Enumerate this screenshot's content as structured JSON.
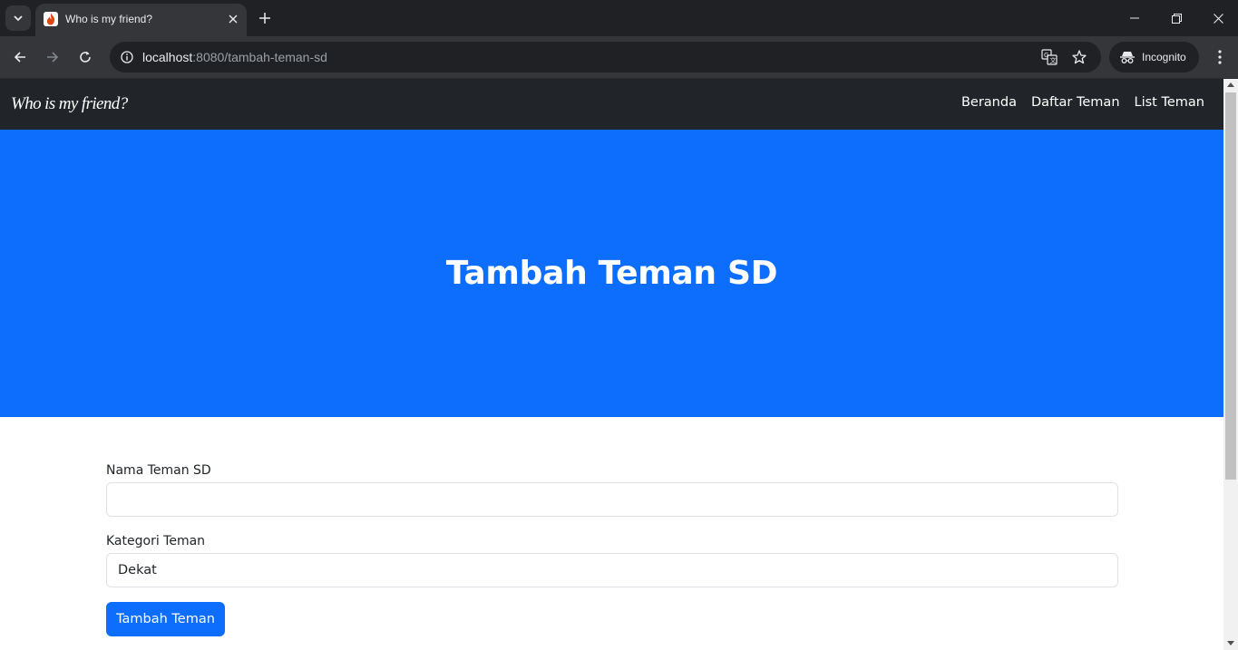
{
  "browser": {
    "tab_title": "Who is my friend?",
    "url_host": "localhost",
    "url_rest": ":8080/tambah-teman-sd",
    "incognito_label": "Incognito"
  },
  "navbar": {
    "brand": "Who is my friend?",
    "links": [
      "Beranda",
      "Daftar Teman",
      "List Teman"
    ]
  },
  "hero": {
    "title": "Tambah Teman SD",
    "background": "#0d6efd"
  },
  "form": {
    "name_label": "Nama Teman SD",
    "name_value": "",
    "category_label": "Kategori Teman",
    "category_value": "Dekat",
    "submit_label": "Tambah Teman"
  },
  "colors": {
    "navbar": "#212529",
    "primary": "#0d6efd"
  },
  "icons": [
    "tab-search-icon",
    "favicon-flame-icon",
    "close-icon",
    "plus-icon",
    "minimize-icon",
    "restore-icon",
    "window-close-icon",
    "back-icon",
    "forward-icon",
    "reload-icon",
    "site-info-icon",
    "translate-icon",
    "star-icon",
    "incognito-icon",
    "more-icon"
  ]
}
